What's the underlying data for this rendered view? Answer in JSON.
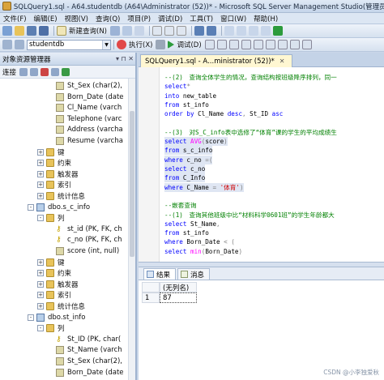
{
  "window": {
    "title": "SQLQuery1.sql - A64.studentdb (A64\\Administrator (52))* - Microsoft SQL Server Management Studio(管理员)"
  },
  "menu": [
    "文件(F)",
    "编辑(E)",
    "视图(V)",
    "查询(Q)",
    "项目(P)",
    "调试(D)",
    "工具(T)",
    "窗口(W)",
    "帮助(H)"
  ],
  "toolbar": {
    "new_query_label": "新建查询(N)",
    "database_value": "studentdb",
    "execute_label": "执行(X)",
    "debug_label": "调试(D)"
  },
  "object_explorer": {
    "title": "对象资源管理器",
    "connect_label": "连接",
    "tree": [
      {
        "label": "St_Sex (char(2),",
        "icon": "column-icon",
        "indent": 4,
        "expander": ""
      },
      {
        "label": "Born_Date (date",
        "icon": "column-icon",
        "indent": 4,
        "expander": ""
      },
      {
        "label": "Cl_Name (varch",
        "icon": "column-icon",
        "indent": 4,
        "expander": ""
      },
      {
        "label": "Telephone (varc",
        "icon": "column-icon",
        "indent": 4,
        "expander": ""
      },
      {
        "label": "Address (varcha",
        "icon": "column-icon",
        "indent": 4,
        "expander": ""
      },
      {
        "label": "Resume (varcha",
        "icon": "column-icon",
        "indent": 4,
        "expander": ""
      },
      {
        "label": "键",
        "icon": "folder-icon",
        "indent": 3,
        "expander": "+"
      },
      {
        "label": "约束",
        "icon": "folder-icon",
        "indent": 3,
        "expander": "+"
      },
      {
        "label": "触发器",
        "icon": "folder-icon",
        "indent": 3,
        "expander": "+"
      },
      {
        "label": "索引",
        "icon": "folder-icon",
        "indent": 3,
        "expander": "+"
      },
      {
        "label": "统计信息",
        "icon": "folder-icon",
        "indent": 3,
        "expander": "+"
      },
      {
        "label": "dbo.s_c_info",
        "icon": "table-icon",
        "indent": 2,
        "expander": "-"
      },
      {
        "label": "列",
        "icon": "folder-icon",
        "indent": 3,
        "expander": "-"
      },
      {
        "label": "st_id (PK, FK, ch",
        "icon": "key-icon",
        "indent": 4,
        "expander": ""
      },
      {
        "label": "c_no (PK, FK, ch",
        "icon": "key-icon",
        "indent": 4,
        "expander": ""
      },
      {
        "label": "score (int, null)",
        "icon": "column-icon",
        "indent": 4,
        "expander": ""
      },
      {
        "label": "键",
        "icon": "folder-icon",
        "indent": 3,
        "expander": "+"
      },
      {
        "label": "约束",
        "icon": "folder-icon",
        "indent": 3,
        "expander": "+"
      },
      {
        "label": "触发器",
        "icon": "folder-icon",
        "indent": 3,
        "expander": "+"
      },
      {
        "label": "索引",
        "icon": "folder-icon",
        "indent": 3,
        "expander": "+"
      },
      {
        "label": "统计信息",
        "icon": "folder-icon",
        "indent": 3,
        "expander": "+"
      },
      {
        "label": "dbo.st_info",
        "icon": "table-icon",
        "indent": 2,
        "expander": "-"
      },
      {
        "label": "列",
        "icon": "folder-icon",
        "indent": 3,
        "expander": "-"
      },
      {
        "label": "St_ID (PK, char(",
        "icon": "key-icon",
        "indent": 4,
        "expander": ""
      },
      {
        "label": "St_Name (varch",
        "icon": "column-icon",
        "indent": 4,
        "expander": ""
      },
      {
        "label": "St_Sex (char(2),",
        "icon": "column-icon",
        "indent": 4,
        "expander": ""
      },
      {
        "label": "Born_Date (date",
        "icon": "column-icon",
        "indent": 4,
        "expander": ""
      }
    ]
  },
  "editor": {
    "tab_label": "SQLQuery1.sql - A...ministrator (52))*",
    "lines": [
      [
        {
          "t": "--(2)　查询全体学生的情况，查询结构按班级降序排列，同一",
          "c": "cm"
        }
      ],
      [
        {
          "t": "select",
          "c": "kw"
        },
        {
          "t": "*",
          "c": "gr"
        }
      ],
      [
        {
          "t": "into",
          "c": "kw"
        },
        {
          "t": " new_table",
          "c": ""
        }
      ],
      [
        {
          "t": "from",
          "c": "kw"
        },
        {
          "t": " st_info",
          "c": ""
        }
      ],
      [
        {
          "t": "order by",
          "c": "kw"
        },
        {
          "t": " Cl_Name ",
          "c": ""
        },
        {
          "t": "desc",
          "c": "kw"
        },
        {
          "t": ",",
          "c": "gr"
        },
        {
          "t": " St_ID ",
          "c": ""
        },
        {
          "t": "asc",
          "c": "kw"
        }
      ],
      [
        {
          "t": "",
          "c": ""
        }
      ],
      [
        {
          "t": "--(3)　对S_C_info表中选修了“体育”课的学生的平均成绩生",
          "c": "cm"
        }
      ],
      [
        {
          "t": "select",
          "c": "kw"
        },
        {
          "t": " ",
          "c": ""
        },
        {
          "t": "AVG",
          "c": "fn"
        },
        {
          "t": "(",
          "c": "gr"
        },
        {
          "t": "score",
          "c": ""
        },
        {
          "t": ")",
          "c": "gr"
        }
      ],
      [
        {
          "t": "from",
          "c": "kw"
        },
        {
          "t": " s_c_info",
          "c": ""
        }
      ],
      [
        {
          "t": "where",
          "c": "kw"
        },
        {
          "t": " c_no ",
          "c": ""
        },
        {
          "t": "=",
          "c": "gr"
        },
        {
          "t": "(",
          "c": "gr"
        }
      ],
      [
        {
          "t": "select",
          "c": "kw"
        },
        {
          "t": " c_no",
          "c": ""
        }
      ],
      [
        {
          "t": "from",
          "c": "kw"
        },
        {
          "t": " C_Info",
          "c": ""
        }
      ],
      [
        {
          "t": "where",
          "c": "kw"
        },
        {
          "t": " C_Name ",
          "c": ""
        },
        {
          "t": "=",
          "c": "gr"
        },
        {
          "t": " ",
          "c": ""
        },
        {
          "t": "'体育'",
          "c": "str"
        },
        {
          "t": ")",
          "c": "gr"
        }
      ],
      [
        {
          "t": "",
          "c": ""
        }
      ],
      [
        {
          "t": "--嵌套查询",
          "c": "cm"
        }
      ],
      [
        {
          "t": "--(1)　查询其他班级中比“材料科学0601班”的学生年龄都大",
          "c": "cm"
        }
      ],
      [
        {
          "t": "select",
          "c": "kw"
        },
        {
          "t": " St_Name",
          "c": ""
        },
        {
          "t": ",",
          "c": "gr"
        }
      ],
      [
        {
          "t": "from",
          "c": "kw"
        },
        {
          "t": " st_info",
          "c": ""
        }
      ],
      [
        {
          "t": "where",
          "c": "kw"
        },
        {
          "t": " Born_Date ",
          "c": ""
        },
        {
          "t": "<",
          "c": "gr"
        },
        {
          "t": " (",
          "c": "gr"
        }
      ],
      [
        {
          "t": "select",
          "c": "kw"
        },
        {
          "t": " ",
          "c": ""
        },
        {
          "t": "min",
          "c": "fn"
        },
        {
          "t": "(",
          "c": "gr"
        },
        {
          "t": "Born_Date",
          "c": ""
        },
        {
          "t": ")",
          "c": "gr"
        }
      ]
    ]
  },
  "results": {
    "tab_results": "结果",
    "tab_messages": "消息",
    "column_header": "(无列名)",
    "row_number": "1",
    "cell_value": "87"
  },
  "watermark": "CSDN @小李独爱秋"
}
